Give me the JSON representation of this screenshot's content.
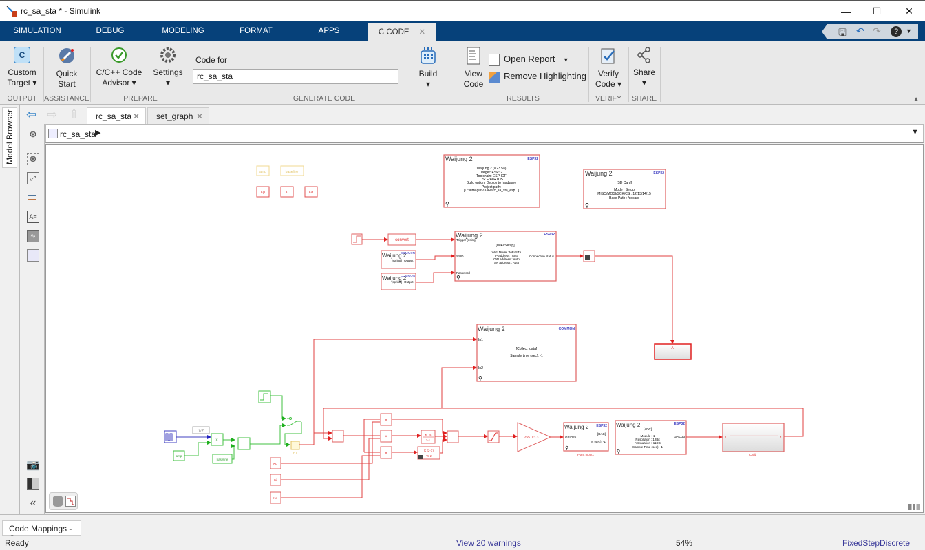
{
  "window": {
    "title": "rc_sa_sta * - Simulink",
    "controls": {
      "minimize": "—",
      "maximize": "☐",
      "close": "✕"
    }
  },
  "ribbon_tabs": [
    {
      "label": "SIMULATION"
    },
    {
      "label": "DEBUG"
    },
    {
      "label": "MODELING"
    },
    {
      "label": "FORMAT"
    },
    {
      "label": "APPS"
    },
    {
      "label": "C CODE",
      "active": true,
      "close": "✕"
    }
  ],
  "quick_access": {
    "save": "save-icon",
    "undo": "undo-icon",
    "redo": "redo-icon",
    "help": "help-icon"
  },
  "ribbon": {
    "output": {
      "custom_target_line1": "Custom",
      "custom_target_line2": "Target ▾",
      "section": "OUTPUT"
    },
    "assistance": {
      "quick_start_line1": "Quick",
      "quick_start_line2": "Start",
      "section": "ASSISTANCE"
    },
    "prepare": {
      "advisor_line1": "C/C++ Code",
      "advisor_line2": "Advisor ▾",
      "settings": "Settings",
      "settings_arrow": "▾",
      "section": "PREPARE"
    },
    "generate_code": {
      "code_for_label": "Code for",
      "code_for_value": "rc_sa_sta",
      "build": "Build",
      "build_arrow": "▾",
      "section": "GENERATE CODE"
    },
    "results": {
      "view_code_line1": "View",
      "view_code_line2": "Code",
      "open_report": "Open Report",
      "open_report_arrow": "▾",
      "remove_highlighting": "Remove Highlighting",
      "section": "RESULTS"
    },
    "verify": {
      "verify_line1": "Verify",
      "verify_line2": "Code ▾",
      "section": "VERIFY"
    },
    "share": {
      "label": "Share",
      "arrow": "▾",
      "section": "SHARE"
    }
  },
  "model_browser": {
    "label": "Model Browser"
  },
  "doc_tabs": [
    {
      "label": "rc_sa_sta",
      "active": true,
      "close": "✕"
    },
    {
      "label": "set_graph",
      "close": "✕"
    }
  ],
  "breadcrumb": {
    "model": "rc_sa_sta",
    "arrow": "▶",
    "dropdown": "▼"
  },
  "diagram": {
    "tags": {
      "amp": "amp",
      "baseline": "baseline",
      "kp": "Kp",
      "ki": "Ki",
      "kd": "Kd"
    },
    "brand": "Waijung 2",
    "target_block": {
      "badge": "ESP32",
      "lines": [
        "Waijung 2 (v.23.5a)",
        "Target: ESP32",
        "Toolchain: ESP-IDF",
        "OS: FreeRTOS",
        "Build option: Deploy to hardware",
        "Project path:",
        "[D:\\aimagin\\23360\\rc_sa_sta_esp...]"
      ]
    },
    "sdcard_block": {
      "badge": "ESP32",
      "lines": [
        "[SD Card]",
        "",
        "Mode : Setup",
        "MISO/MOSI/SCK/CS : 12/13/14/15",
        "Base Path : /sdcard"
      ]
    },
    "convert_block": {
      "label": "convert"
    },
    "sprintf_block_1": {
      "badge": "COMMON",
      "port_left": "[sprintf]",
      "port_right": "Output"
    },
    "sprintf_block_2": {
      "badge": "COMMON",
      "port_left": "[sprintf]",
      "port_right": "Output"
    },
    "wifi_block": {
      "badge": "ESP32",
      "title": "[WiFi Setup]",
      "port_trigger": "Trigger (rising)",
      "port_ssid": "SSID",
      "port_password": "Password",
      "lines": [
        "WiFi Mode: WiFi STA",
        "IP address    : Auto",
        "GW address  : Auto",
        "SN address  : Auto"
      ],
      "out": "Connection status"
    },
    "collect_block": {
      "badge": "COMMON",
      "in1": "In1",
      "in2": "In2",
      "title": "[Collect_data]",
      "sample": "Sample time (sec): -1"
    },
    "delay_label": "1/Z",
    "product": "×",
    "rt_label": "RT",
    "integrator": {
      "num": "K Ts",
      "den": "z-1"
    },
    "derivative": {
      "num": "K (z-1)",
      "den": "Ts z"
    },
    "gain": "255.0/3.3",
    "dac_block": {
      "badge": "ESP32",
      "title": "[DAC]",
      "port": "GPIO25",
      "ts": "Ts (sec): -1",
      "caption": "Plant Input1"
    },
    "adc_block": {
      "badge": "ESP32",
      "title": "[ADC]",
      "lines": [
        "Module : 1",
        "Resolution : 12Bit",
        "Attenuation : 11DB",
        "Sample Time (sec): -1"
      ],
      "port": "GPIO33"
    },
    "calib_block": {
      "caption": "Calib",
      "in": "1",
      "out": "1"
    }
  },
  "bottom": {
    "code_mappings_tab": "Code Mappings - C"
  },
  "status": {
    "ready": "Ready",
    "warnings": "View 20 warnings",
    "zoom": "54%",
    "solver": "FixedStepDiscrete"
  }
}
